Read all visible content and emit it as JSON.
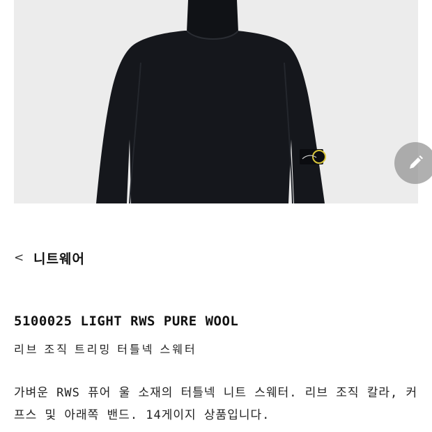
{
  "product": {
    "image_alt": "black turtleneck knit sweater",
    "background_color": "#ececec",
    "garment_color": "#15171c"
  },
  "edit_button": {
    "icon": "pencil-icon"
  },
  "breadcrumb": {
    "back_symbol": "<",
    "category": "니트웨어"
  },
  "title": "5100025 LIGHT RWS PURE WOOL",
  "subtitle": "리브 조직 트리밍 터틀넥 스웨터",
  "description": "가벼운 RWS 퓨어 울 소재의 터틀넥 니트 스웨터. 리브 조직 칼라, 커프스 및 아래쪽 밴드. 14게이지 상품입니다."
}
